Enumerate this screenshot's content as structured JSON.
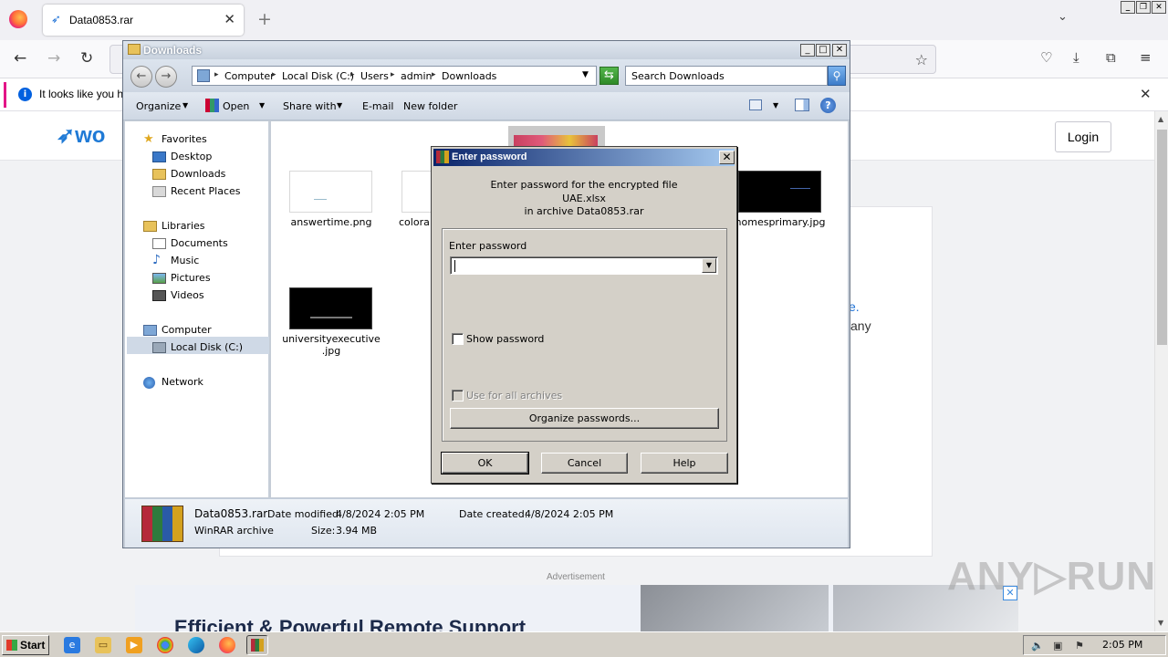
{
  "browser": {
    "tab_title": "Data0853.rar",
    "tab_icon": "rocket-icon",
    "notification_text": "It looks like you ha",
    "controls": {
      "minimize": "_",
      "restore": "❐",
      "close": "✕"
    }
  },
  "webpage": {
    "logo_text": "wo",
    "login_label": "Login",
    "link_fragment": "e.",
    "text_fragment": "any",
    "ad_label": "Advertisement",
    "ad_headline": "Efficient & Powerful Remote Support",
    "ad_close": "✕"
  },
  "watermark": "ANY▷RUN",
  "explorer": {
    "title": "Downloads",
    "breadcrumbs": [
      "Computer",
      "Local Disk (C:)",
      "Users",
      "admin",
      "Downloads"
    ],
    "search_placeholder": "Search Downloads",
    "toolbar": {
      "organize": "Organize",
      "open": "Open",
      "share_with": "Share with",
      "email": "E-mail",
      "new_folder": "New folder",
      "help": "?"
    },
    "nav": {
      "favorites": "Favorites",
      "desktop": "Desktop",
      "downloads": "Downloads",
      "recent_places": "Recent Places",
      "libraries": "Libraries",
      "documents": "Documents",
      "music": "Music",
      "pictures": "Pictures",
      "videos": "Videos",
      "computer": "Computer",
      "local_disk": "Local Disk (C:)",
      "network": "Network"
    },
    "files": [
      {
        "name": "answertime.png"
      },
      {
        "name": "colora"
      },
      {
        "name": "homesprimary.jpg"
      },
      {
        "name": "universityexecutive\n.jpg",
        "line1": "universityexecutive",
        "line2": ".jpg"
      }
    ],
    "details": {
      "filename": "Data0853.rar",
      "type": "WinRAR archive",
      "modified_label": "Date modified:",
      "modified_value": "4/8/2024 2:05 PM",
      "created_label": "Date created:",
      "created_value": "4/8/2024 2:05 PM",
      "size_label": "Size:",
      "size_value": "3.94 MB"
    }
  },
  "dialog": {
    "title": "Enter password",
    "msg_line1": "Enter password for the encrypted file",
    "msg_line2": "UAE.xlsx",
    "msg_line3": "in archive Data0853.rar",
    "password_label": "Enter password",
    "password_value": "",
    "show_password": "Show password",
    "use_for_all": "Use for all archives",
    "organize_passwords": "Organize passwords...",
    "ok": "OK",
    "cancel": "Cancel",
    "help": "Help",
    "close": "✕"
  },
  "taskbar": {
    "start": "Start",
    "clock": "2:05 PM"
  }
}
